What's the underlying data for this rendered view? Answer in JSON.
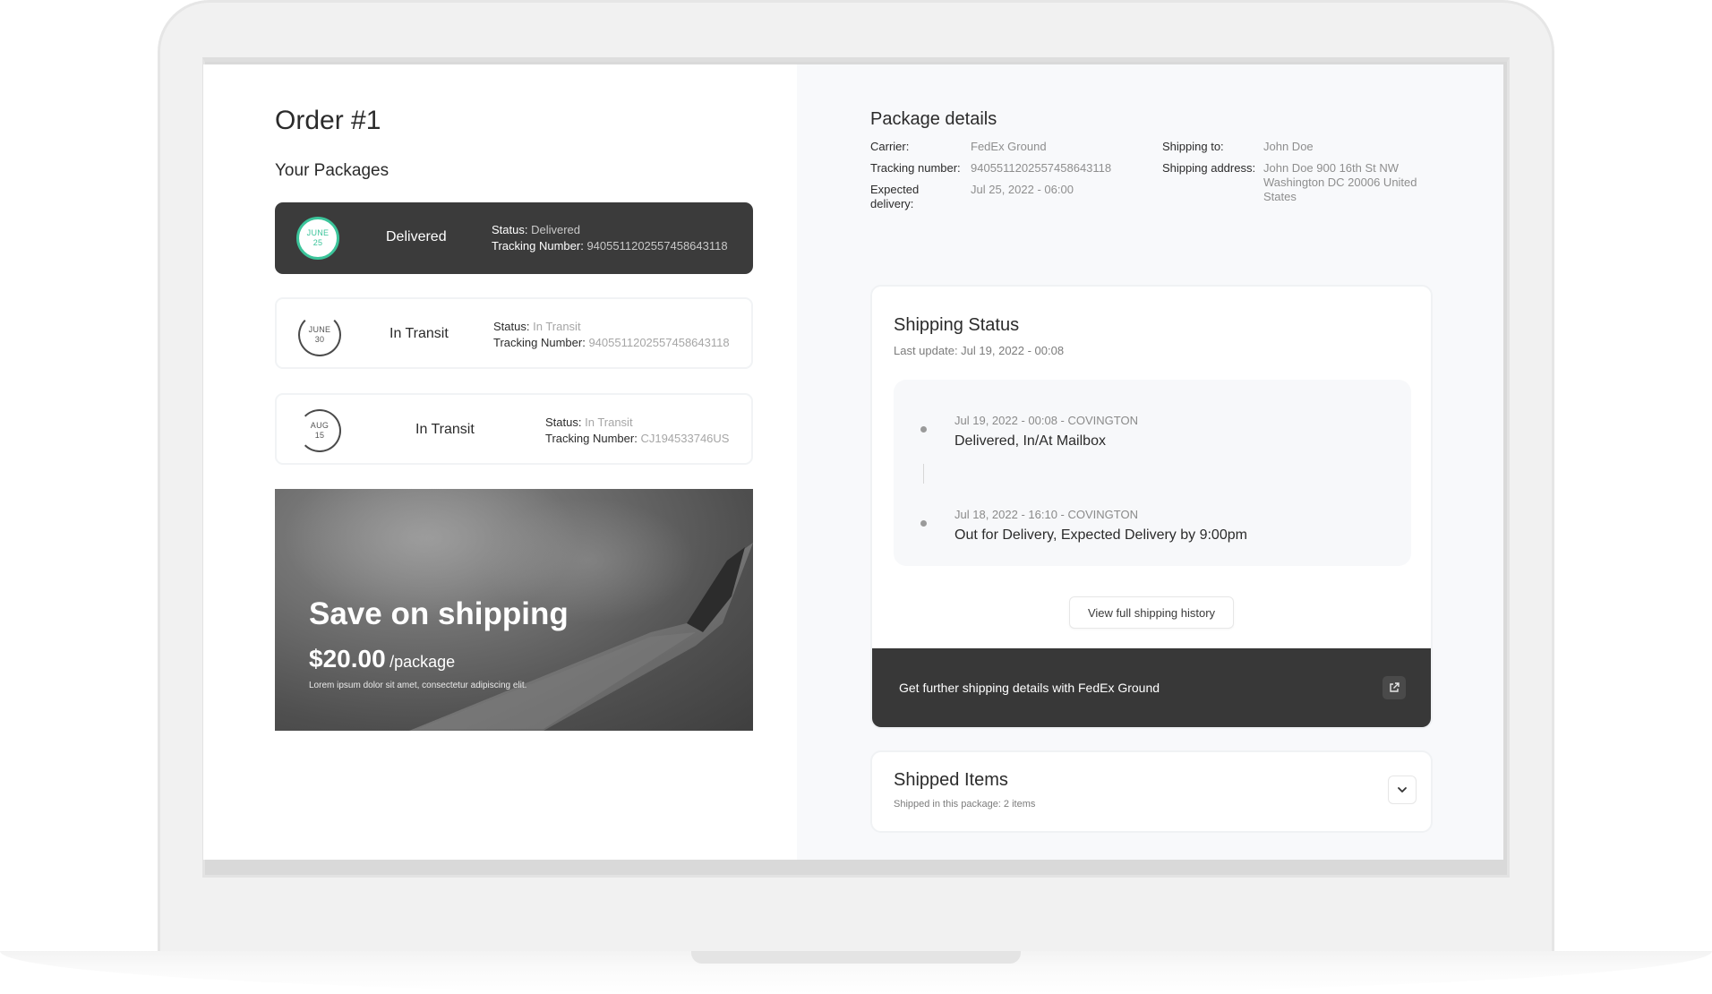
{
  "order": {
    "title": "Order #1",
    "packages_heading": "Your Packages"
  },
  "packages": [
    {
      "month": "JUNE",
      "day": "25",
      "label": "Delivered",
      "status_key": "Status:",
      "status": "Delivered",
      "tracking_key": "Tracking Number:",
      "tracking": "9405511202557458643118"
    },
    {
      "month": "JUNE",
      "day": "30",
      "label": "In Transit",
      "status_key": "Status:",
      "status": "In Transit",
      "tracking_key": "Tracking Number:",
      "tracking": "9405511202557458643118"
    },
    {
      "month": "AUG",
      "day": "15",
      "label": "In Transit",
      "status_key": "Status:",
      "status": "In Transit",
      "tracking_key": "Tracking Number:",
      "tracking": "CJ194533746US"
    }
  ],
  "promo": {
    "title": "Save on shipping",
    "price": "$20.00",
    "unit": "/package",
    "description": "Lorem ipsum dolor sit amet, consectetur adipiscing elit."
  },
  "package_details": {
    "title": "Package details",
    "carrier_key": "Carrier:",
    "carrier": "FedEx Ground",
    "tracking_key": "Tracking number:",
    "tracking": "9405511202557458643118",
    "expected_key": "Expected delivery:",
    "expected": "Jul 25, 2022 - 06:00",
    "ship_to_key": "Shipping to:",
    "ship_to": "John Doe",
    "address_key": "Shipping address:",
    "address": "John Doe 900 16th St NW Washington DC 20006 United States"
  },
  "shipping_status": {
    "title": "Shipping Status",
    "last_update": "Last update: Jul 19, 2022 - 00:08",
    "events": [
      {
        "meta": "Jul 19, 2022 - 00:08 - COVINGTON",
        "event": "Delivered, In/At Mailbox"
      },
      {
        "meta": "Jul 18, 2022 - 16:10 - COVINGTON",
        "event": "Out for Delivery, Expected Delivery by 9:00pm"
      }
    ],
    "history_button": "View full shipping history",
    "carrier_link": "Get further shipping details with FedEx Ground"
  },
  "shipped_items": {
    "title": "Shipped Items",
    "subtitle": "Shipped in this package: 2 items"
  },
  "colors": {
    "accent_green": "#3bc49a",
    "dark": "#383838",
    "muted": "#8e8e8e"
  },
  "icons": {
    "external_link": "external-link-icon",
    "chevron": "chevron-down-icon"
  }
}
